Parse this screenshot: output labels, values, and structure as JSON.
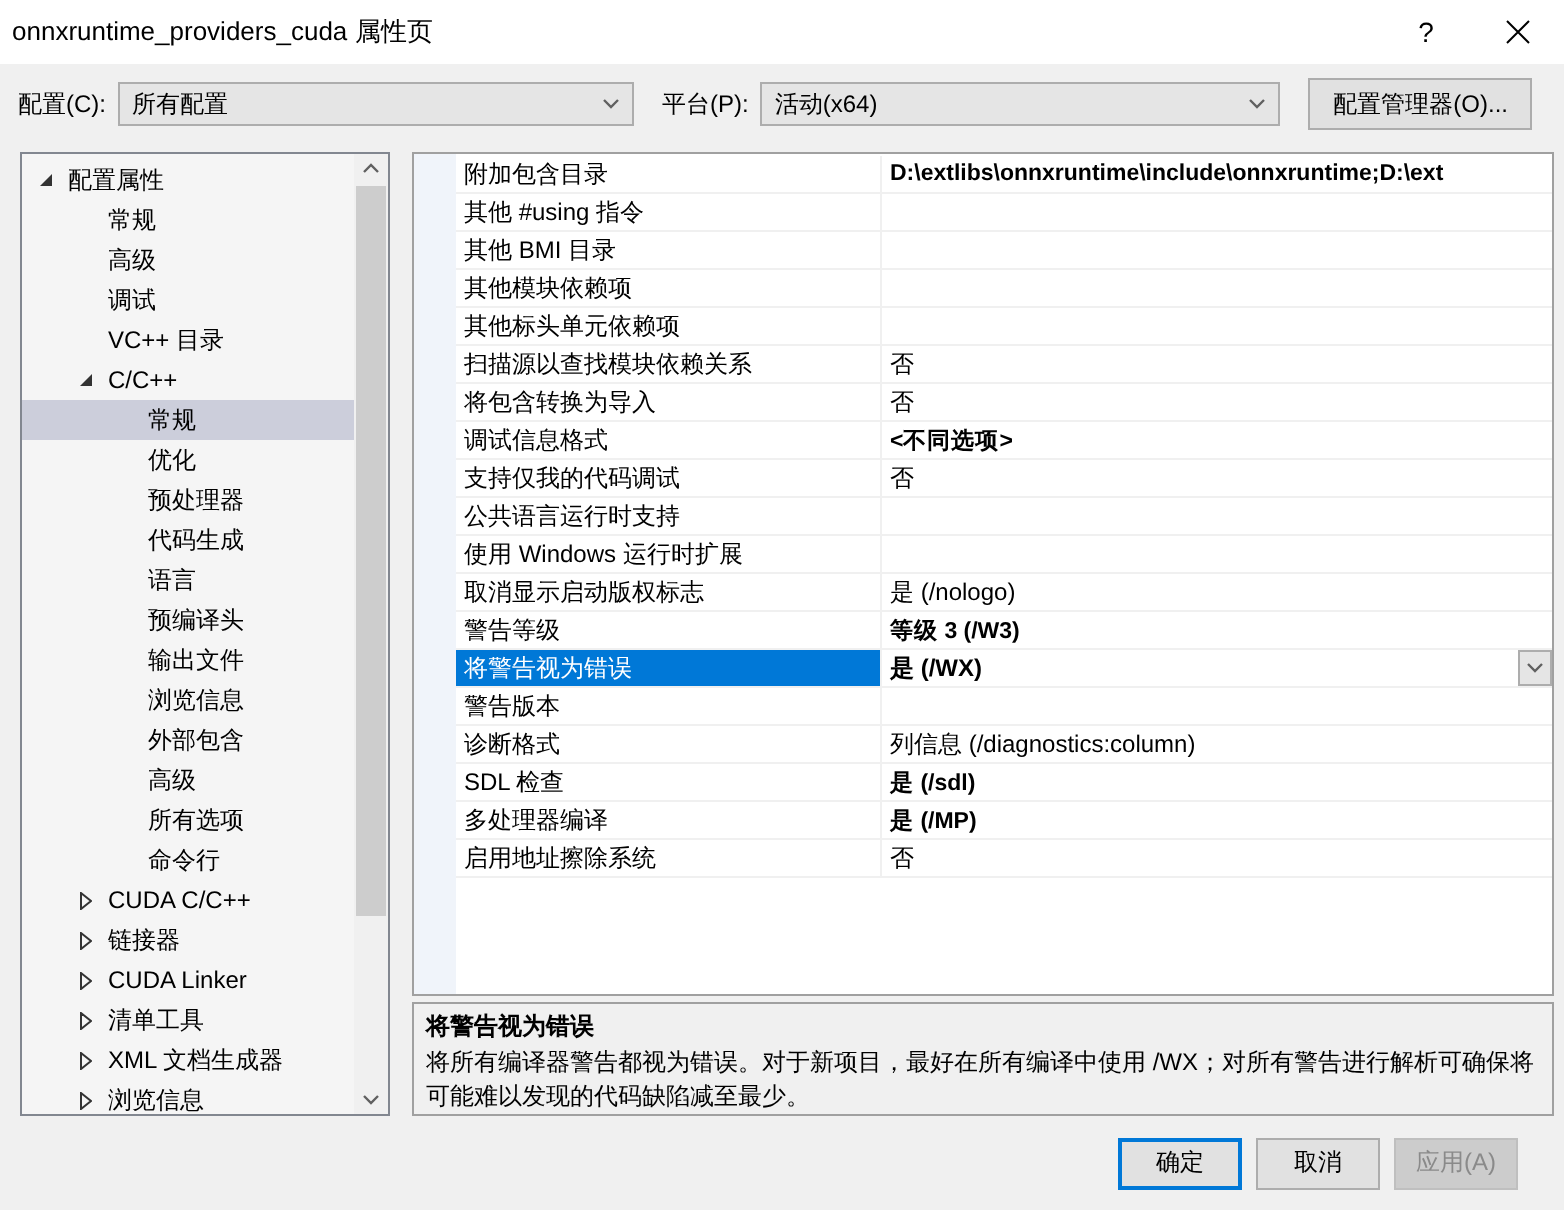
{
  "window": {
    "title": "onnxruntime_providers_cuda 属性页",
    "help": "?"
  },
  "toolbar": {
    "config_label": "配置(C):",
    "config_value": "所有配置",
    "platform_label": "平台(P):",
    "platform_value": "活动(x64)",
    "manager_button": "配置管理器(O)..."
  },
  "tree": [
    {
      "label": "配置属性",
      "expanded": true,
      "selected": false,
      "children": [
        {
          "label": "常规",
          "selected": false
        },
        {
          "label": "高级",
          "selected": false
        },
        {
          "label": "调试",
          "selected": false
        },
        {
          "label": "VC++ 目录",
          "selected": false
        },
        {
          "label": "C/C++",
          "expanded": true,
          "selected": false,
          "children": [
            {
              "label": "常规",
              "selected": true
            },
            {
              "label": "优化",
              "selected": false
            },
            {
              "label": "预处理器",
              "selected": false
            },
            {
              "label": "代码生成",
              "selected": false
            },
            {
              "label": "语言",
              "selected": false
            },
            {
              "label": "预编译头",
              "selected": false
            },
            {
              "label": "输出文件",
              "selected": false
            },
            {
              "label": "浏览信息",
              "selected": false
            },
            {
              "label": "外部包含",
              "selected": false
            },
            {
              "label": "高级",
              "selected": false
            },
            {
              "label": "所有选项",
              "selected": false
            },
            {
              "label": "命令行",
              "selected": false
            }
          ]
        },
        {
          "label": "CUDA C/C++",
          "expanded": false,
          "selected": false
        },
        {
          "label": "链接器",
          "expanded": false,
          "selected": false
        },
        {
          "label": "CUDA Linker",
          "expanded": false,
          "selected": false
        },
        {
          "label": "清单工具",
          "expanded": false,
          "selected": false
        },
        {
          "label": "XML 文档生成器",
          "expanded": false,
          "selected": false
        },
        {
          "label": "浏览信息",
          "expanded": false,
          "selected": false
        }
      ]
    }
  ],
  "properties": [
    {
      "name": "附加包含目录",
      "value": "D:\\extlibs\\onnxruntime\\include\\onnxruntime;D:\\ext",
      "bold": true,
      "selected": false
    },
    {
      "name": "其他 #using 指令",
      "selected": false
    },
    {
      "name": "其他 BMI 目录",
      "selected": false
    },
    {
      "name": "其他模块依赖项",
      "selected": false
    },
    {
      "name": "其他标头单元依赖项",
      "selected": false
    },
    {
      "name": "扫描源以查找模块依赖关系",
      "value": "否",
      "bold": false,
      "selected": false
    },
    {
      "name": "将包含转换为导入",
      "value": "否",
      "bold": false,
      "selected": false
    },
    {
      "name": "调试信息格式",
      "value": "<不同选项>",
      "bold": true,
      "selected": false
    },
    {
      "name": "支持仅我的代码调试",
      "value": "否",
      "bold": false,
      "selected": false
    },
    {
      "name": "公共语言运行时支持",
      "selected": false
    },
    {
      "name": "使用 Windows 运行时扩展",
      "selected": false
    },
    {
      "name": "取消显示启动版权标志",
      "value": "是 (/nologo)",
      "bold": false,
      "selected": false
    },
    {
      "name": "警告等级",
      "value": "等级 3 (/W3)",
      "bold": true,
      "selected": false
    },
    {
      "name": "将警告视为错误",
      "value": "是 (/WX)",
      "bold": true,
      "selected": true
    },
    {
      "name": "警告版本",
      "selected": false
    },
    {
      "name": "诊断格式",
      "value": "列信息 (/diagnostics:column)",
      "bold": false,
      "selected": false
    },
    {
      "name": "SDL 检查",
      "value": "是 (/sdl)",
      "bold": true,
      "selected": false
    },
    {
      "name": "多处理器编译",
      "value": "是 (/MP)",
      "bold": true,
      "selected": false
    },
    {
      "name": "启用地址擦除系统",
      "value": "否",
      "bold": false,
      "selected": false
    }
  ],
  "description": {
    "title": "将警告视为错误",
    "text": "将所有编译器警告都视为错误。对于新项目，最好在所有编译中使用 /WX；对所有警告进行解析可确保将可能难以发现的代码缺陷减至最少。"
  },
  "buttons": [
    {
      "label": "确定",
      "default": true,
      "disabled": false
    },
    {
      "label": "取消",
      "default": false,
      "disabled": false
    },
    {
      "label": "应用(A)",
      "default": false,
      "disabled": true
    }
  ]
}
